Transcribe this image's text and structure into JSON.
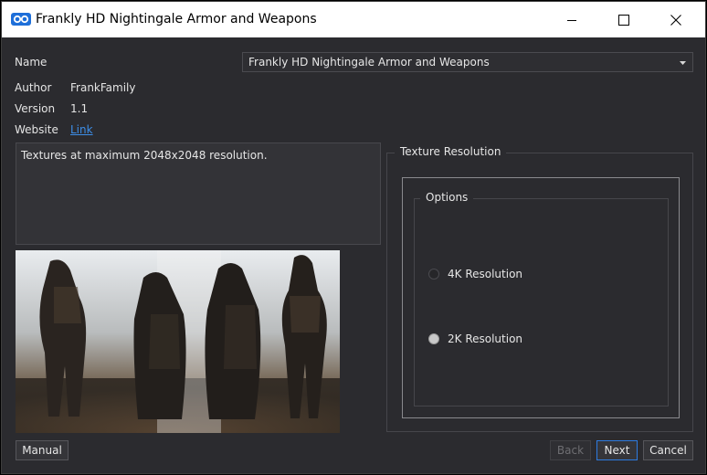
{
  "window": {
    "title": "Frankly HD Nightingale Armor and Weapons"
  },
  "fields": {
    "name_label": "Name",
    "name_value": "Frankly HD Nightingale Armor and Weapons",
    "author_label": "Author",
    "author_value": "FrankFamily",
    "version_label": "Version",
    "version_value": "1.1",
    "website_label": "Website",
    "website_link": "Link"
  },
  "description": "Textures at maximum 2048x2048 resolution.",
  "groups": {
    "outer_title": "Texture Resolution",
    "inner_title": "Options",
    "options": [
      {
        "label": "4K Resolution",
        "selected": false
      },
      {
        "label": "2K Resolution",
        "selected": true
      }
    ]
  },
  "buttons": {
    "manual": "Manual",
    "back": "Back",
    "next": "Next",
    "cancel": "Cancel"
  },
  "colors": {
    "background": "#2b2b2f",
    "accent": "#2d7be0",
    "link": "#3d8ee8"
  }
}
